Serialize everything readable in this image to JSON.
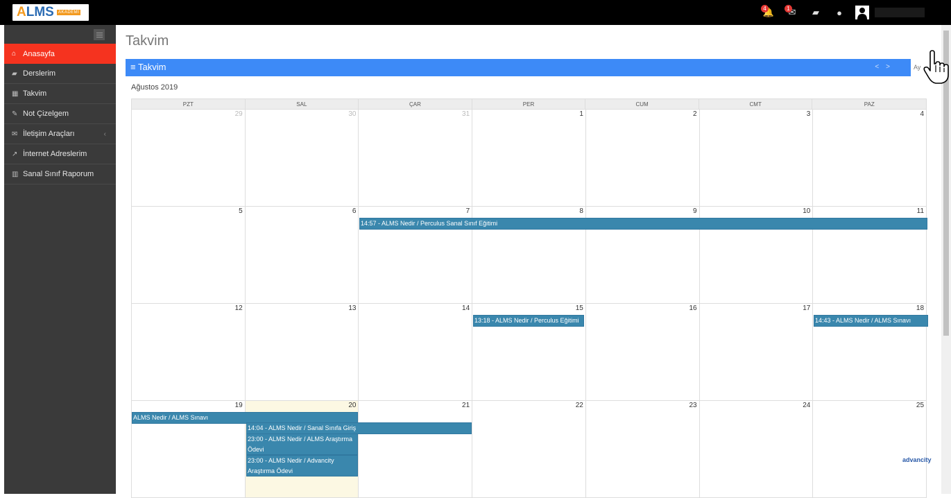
{
  "logo": {
    "main_a": "A",
    "main_rest": "LMS",
    "sub": "AKADEMİ"
  },
  "topbar": {
    "notifications_badge": "4",
    "messages_badge": "1"
  },
  "sidebar": {
    "items": [
      {
        "label": "Anasayfa"
      },
      {
        "label": "Derslerim"
      },
      {
        "label": "Takvim"
      },
      {
        "label": "Not Çizelgem"
      },
      {
        "label": "İletişim Araçları"
      },
      {
        "label": "İnternet Adreslerim"
      },
      {
        "label": "Sanal Sınıf Raporum"
      }
    ]
  },
  "page": {
    "title": "Takvim"
  },
  "panel": {
    "title": "≡ Takvim",
    "prev": "<",
    "next": ">",
    "view": "Ay"
  },
  "calendar": {
    "month_label": "Ağustos 2019",
    "weekdays": [
      "PZT",
      "SAL",
      "ÇAR",
      "PER",
      "CUM",
      "CMT",
      "PAZ"
    ],
    "weeks": [
      [
        "29",
        "30",
        "31",
        "1",
        "2",
        "3",
        "4"
      ],
      [
        "5",
        "6",
        "7",
        "8",
        "9",
        "10",
        "11"
      ],
      [
        "12",
        "13",
        "14",
        "15",
        "16",
        "17",
        "18"
      ],
      [
        "19",
        "20",
        "21",
        "22",
        "23",
        "24",
        "25"
      ]
    ],
    "events": [
      "14:57 - ALMS Nedir / Perculus Sanal Sınıf Eğitimi",
      "13:18 - ALMS Nedir / Perculus Eğitimi",
      "14:43 - ALMS Nedir / ALMS Sınavı",
      "ALMS Nedir / ALMS Sınavı",
      "14:04 - ALMS Nedir / Sanal Sınıfa Giriş",
      "23:00 - ALMS Nedir / ALMS Araştırma Ödevi",
      "23:00 - ALMS Nedir / Advancity Araştırma Ödevi"
    ]
  },
  "watermark": "advancity"
}
